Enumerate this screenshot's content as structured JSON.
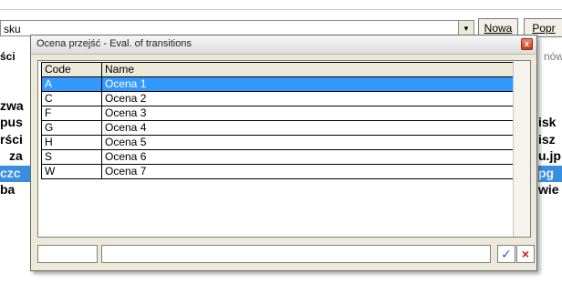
{
  "background": {
    "combo_text": "sku",
    "combo_arrow": "▼",
    "btn_new": "Nowa",
    "btn_prev": "Popr",
    "label_left": "ści",
    "label_right": "nów",
    "left_rows": [
      "zwa",
      "pus",
      "rści",
      "za",
      "czc",
      "ba"
    ],
    "right_rows": [
      "isk",
      "isz",
      "u.jp",
      "pg",
      "wie"
    ]
  },
  "dialog": {
    "title": "Ocena przejść - Eval. of transitions",
    "close_glyph": "x",
    "columns": {
      "code": "Code",
      "name": "Name"
    },
    "rows": [
      {
        "code": "A",
        "name": "Ocena 1"
      },
      {
        "code": "C",
        "name": "Ocena 2"
      },
      {
        "code": "F",
        "name": "Ocena 3"
      },
      {
        "code": "G",
        "name": "Ocena 4"
      },
      {
        "code": "H",
        "name": "Ocena 5"
      },
      {
        "code": "S",
        "name": "Ocena 6"
      },
      {
        "code": "W",
        "name": "Ocena 7"
      }
    ],
    "selected_row": 0,
    "filter_code_value": "",
    "filter_name_value": "",
    "ok_glyph": "✓",
    "cancel_glyph": "×"
  },
  "colors": {
    "selection": "#3399ff",
    "ok": "#1f5fc9",
    "cancel": "#d21a1a"
  }
}
